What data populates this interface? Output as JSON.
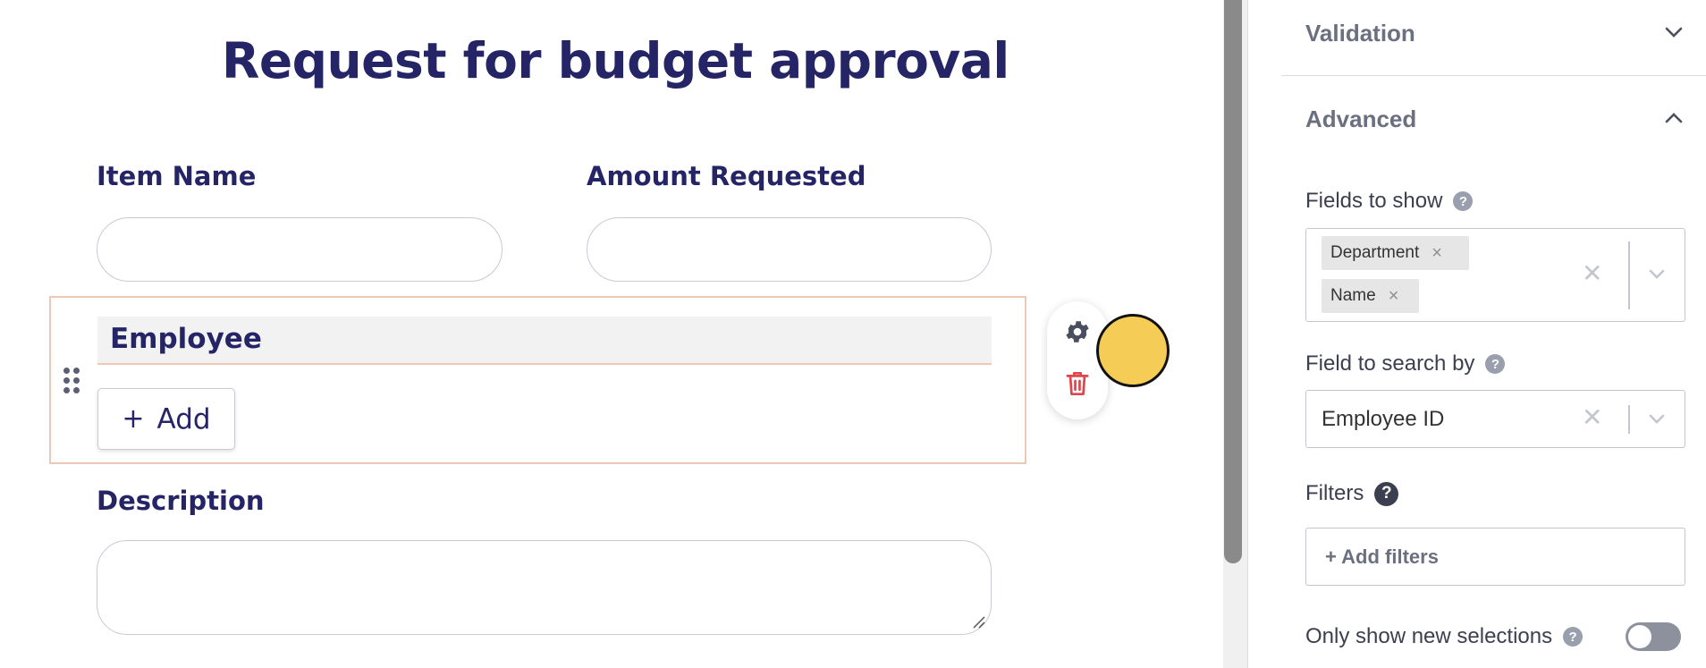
{
  "form": {
    "title": "Request for budget approval",
    "fields": {
      "item_name": {
        "label": "Item Name",
        "value": ""
      },
      "amount_requested": {
        "label": "Amount Requested",
        "value": ""
      },
      "employee": {
        "label": "Employee",
        "add_label": "Add",
        "add_icon": "plus-icon"
      },
      "description": {
        "label": "Description",
        "value": ""
      }
    },
    "tools": {
      "settings_icon": "gear-icon",
      "delete_icon": "trash-icon"
    }
  },
  "panel": {
    "validation": {
      "title": "Validation",
      "expanded": false
    },
    "advanced": {
      "title": "Advanced",
      "expanded": true
    },
    "fields_to_show": {
      "label": "Fields to show",
      "selected": [
        "Department",
        "Name"
      ]
    },
    "field_to_search_by": {
      "label": "Field to search by",
      "value": "Employee ID"
    },
    "filters": {
      "label": "Filters",
      "button": "+ Add filters"
    },
    "only_show_new": {
      "label": "Only show new selections",
      "enabled": false
    },
    "help_glyph": "?",
    "remove_glyph": "×",
    "clear_glyph": "✕"
  },
  "colors": {
    "title": "#252466",
    "selected_outline": "#edc9b5",
    "delete": "#e0454a",
    "cursor": "#f5cc55",
    "muted": "#6b7080"
  }
}
